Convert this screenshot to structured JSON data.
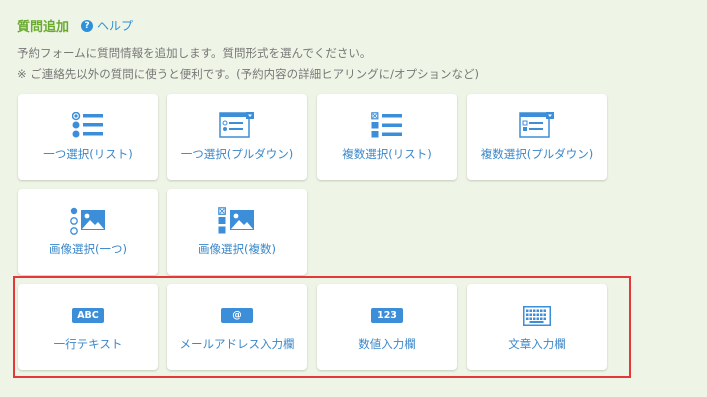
{
  "header": {
    "title": "質問追加",
    "help_label": "ヘルプ",
    "help_glyph": "?"
  },
  "description": {
    "line1": "予約フォームに質問情報を追加します。質問形式を選んでください。",
    "line2": "※ ご連絡先以外の質問に使うと便利です。(予約内容の詳細ヒアリングに/オプションなど)"
  },
  "question_types": [
    {
      "label": "一つ選択(リスト)",
      "icon": "radio-list-icon"
    },
    {
      "label": "一つ選択(プルダウン)",
      "icon": "dropdown-window-icon"
    },
    {
      "label": "複数選択(リスト)",
      "icon": "checkbox-list-icon"
    },
    {
      "label": "複数選択(プルダウン)",
      "icon": "multi-dropdown-window-icon"
    },
    {
      "label": "画像選択(一つ)",
      "icon": "image-radio-icon"
    },
    {
      "label": "画像選択(複数)",
      "icon": "image-checkbox-icon"
    },
    {
      "label": "一行テキスト",
      "icon": "abc-text-icon",
      "badge": "ABC"
    },
    {
      "label": "メールアドレス入力欄",
      "icon": "at-sign-icon",
      "badge": "@"
    },
    {
      "label": "数値入力欄",
      "icon": "number-icon",
      "badge": "123"
    },
    {
      "label": "文章入力欄",
      "icon": "keyboard-icon"
    }
  ],
  "colors": {
    "accent_green": "#6aaa2f",
    "link_blue": "#2f8fd8",
    "icon_blue": "#3d8ed8",
    "highlight_red": "#e53939",
    "background": "#eef5e6"
  }
}
